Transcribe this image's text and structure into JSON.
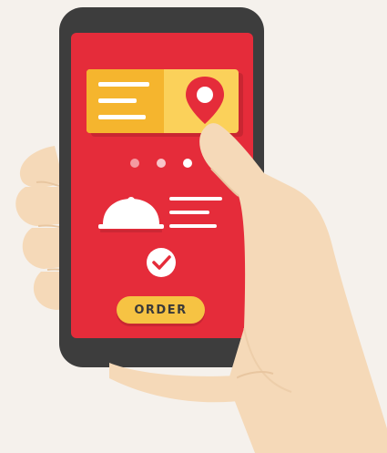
{
  "order_button": {
    "label": "ORDER"
  },
  "carousel": {
    "dots": 3,
    "active_index": 2
  },
  "colors": {
    "background": "#f5f1ec",
    "phone_body": "#3d3d3d",
    "screen": "#e52c3a",
    "card_left": "#f5b52e",
    "card_right": "#fbd15a",
    "pin": "#e52c3a",
    "skin": "#f5d9b8",
    "skin_shadow": "#e8c6a0",
    "button": "#f6c343"
  },
  "icons": {
    "location": "map-pin-icon",
    "food": "food-cloche-icon",
    "confirm": "check-circle-icon"
  }
}
